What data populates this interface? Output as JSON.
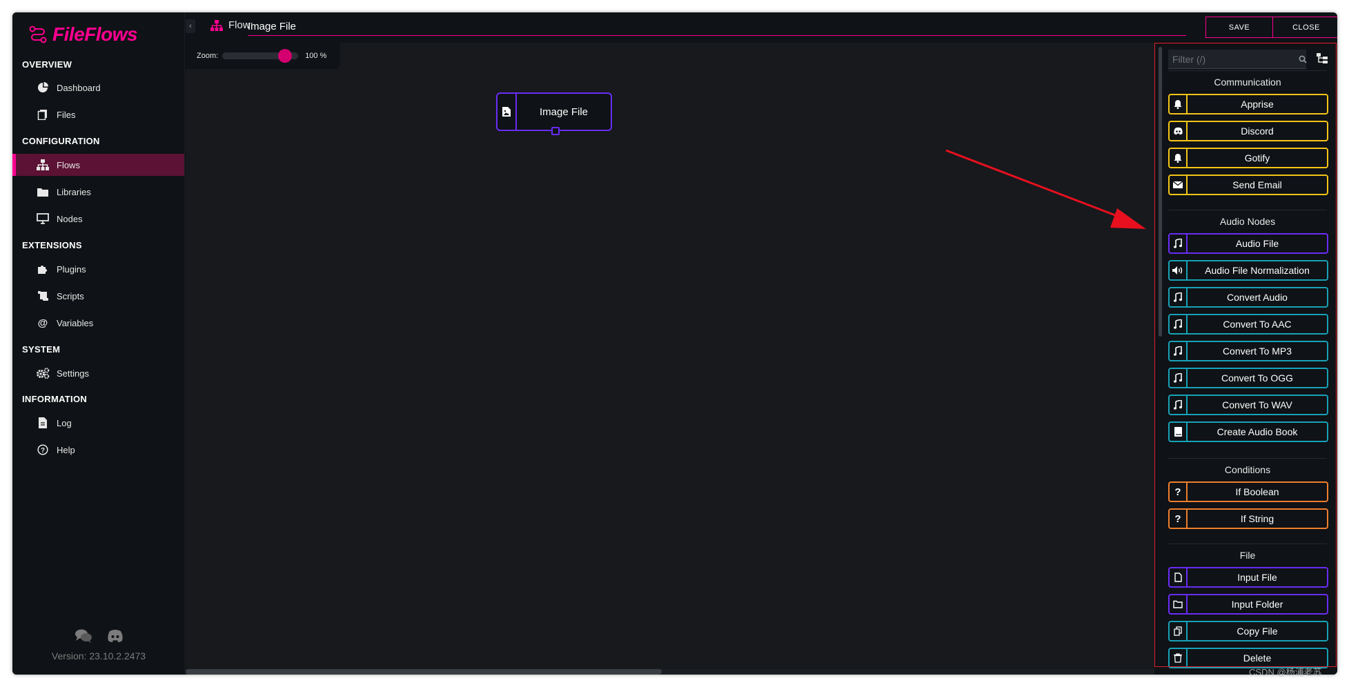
{
  "app": {
    "brand": "FileFlows",
    "brand_color": "#ff0090"
  },
  "sidebar": {
    "sections": [
      {
        "title": "OVERVIEW"
      },
      {
        "title": "CONFIGURATION"
      },
      {
        "title": "EXTENSIONS"
      },
      {
        "title": "SYSTEM"
      },
      {
        "title": "INFORMATION"
      }
    ],
    "items": [
      {
        "label": "Dashboard",
        "icon": "dashboard-icon"
      },
      {
        "label": "Files",
        "icon": "files-icon"
      },
      {
        "label": "Flows",
        "icon": "flows-icon",
        "active": true
      },
      {
        "label": "Libraries",
        "icon": "folder-icon"
      },
      {
        "label": "Nodes",
        "icon": "monitor-icon"
      },
      {
        "label": "Plugins",
        "icon": "puzzle-icon"
      },
      {
        "label": "Scripts",
        "icon": "scroll-icon"
      },
      {
        "label": "Variables",
        "icon": "at-icon"
      },
      {
        "label": "Settings",
        "icon": "gears-icon"
      },
      {
        "label": "Log",
        "icon": "document-icon"
      },
      {
        "label": "Help",
        "icon": "question-circle-icon"
      }
    ],
    "version": "Version: 23.10.2.2473"
  },
  "header": {
    "flow_label": "Flow:",
    "flow_name": "Image File",
    "save_label": "SAVE",
    "close_label": "CLOSE"
  },
  "canvas": {
    "zoom_label": "Zoom:",
    "zoom_value": "100 %",
    "zoom_fraction": 0.9,
    "node_label": "Image File"
  },
  "panel": {
    "filter_placeholder": "Filter (/)",
    "groups": [
      {
        "title": "Communication"
      },
      {
        "title": "Audio Nodes"
      },
      {
        "title": "Conditions"
      },
      {
        "title": "File"
      }
    ],
    "elements": [
      {
        "label": "Apprise",
        "icon": "bell-icon",
        "color": "#f5c518"
      },
      {
        "label": "Discord",
        "icon": "discord-icon",
        "color": "#f5c518"
      },
      {
        "label": "Gotify",
        "icon": "bell-icon",
        "color": "#f5c518"
      },
      {
        "label": "Send Email",
        "icon": "envelope-icon",
        "color": "#f5c518"
      },
      {
        "label": "Audio File",
        "icon": "music-icon",
        "color": "#6a2cf5"
      },
      {
        "label": "Audio File Normalization",
        "icon": "volume-icon",
        "color": "#17a2b8"
      },
      {
        "label": "Convert Audio",
        "icon": "music-icon",
        "color": "#17a2b8"
      },
      {
        "label": "Convert To AAC",
        "icon": "music-icon",
        "color": "#17a2b8"
      },
      {
        "label": "Convert To MP3",
        "icon": "music-icon",
        "color": "#17a2b8"
      },
      {
        "label": "Convert To OGG",
        "icon": "music-icon",
        "color": "#17a2b8"
      },
      {
        "label": "Convert To WAV",
        "icon": "music-icon",
        "color": "#17a2b8"
      },
      {
        "label": "Create Audio Book",
        "icon": "book-icon",
        "color": "#17a2b8"
      },
      {
        "label": "If Boolean",
        "icon": "question-icon",
        "color": "#f07f2c"
      },
      {
        "label": "If String",
        "icon": "question-icon",
        "color": "#f07f2c"
      },
      {
        "label": "Input File",
        "icon": "file-icon",
        "color": "#6a2cf5"
      },
      {
        "label": "Input Folder",
        "icon": "folder-icon",
        "color": "#6a2cf5"
      },
      {
        "label": "Copy File",
        "icon": "copy-icon",
        "color": "#17a2b8"
      },
      {
        "label": "Delete",
        "icon": "trash-icon",
        "color": "#17a2b8"
      }
    ]
  },
  "watermark": "CSDN @杨浦老苏"
}
